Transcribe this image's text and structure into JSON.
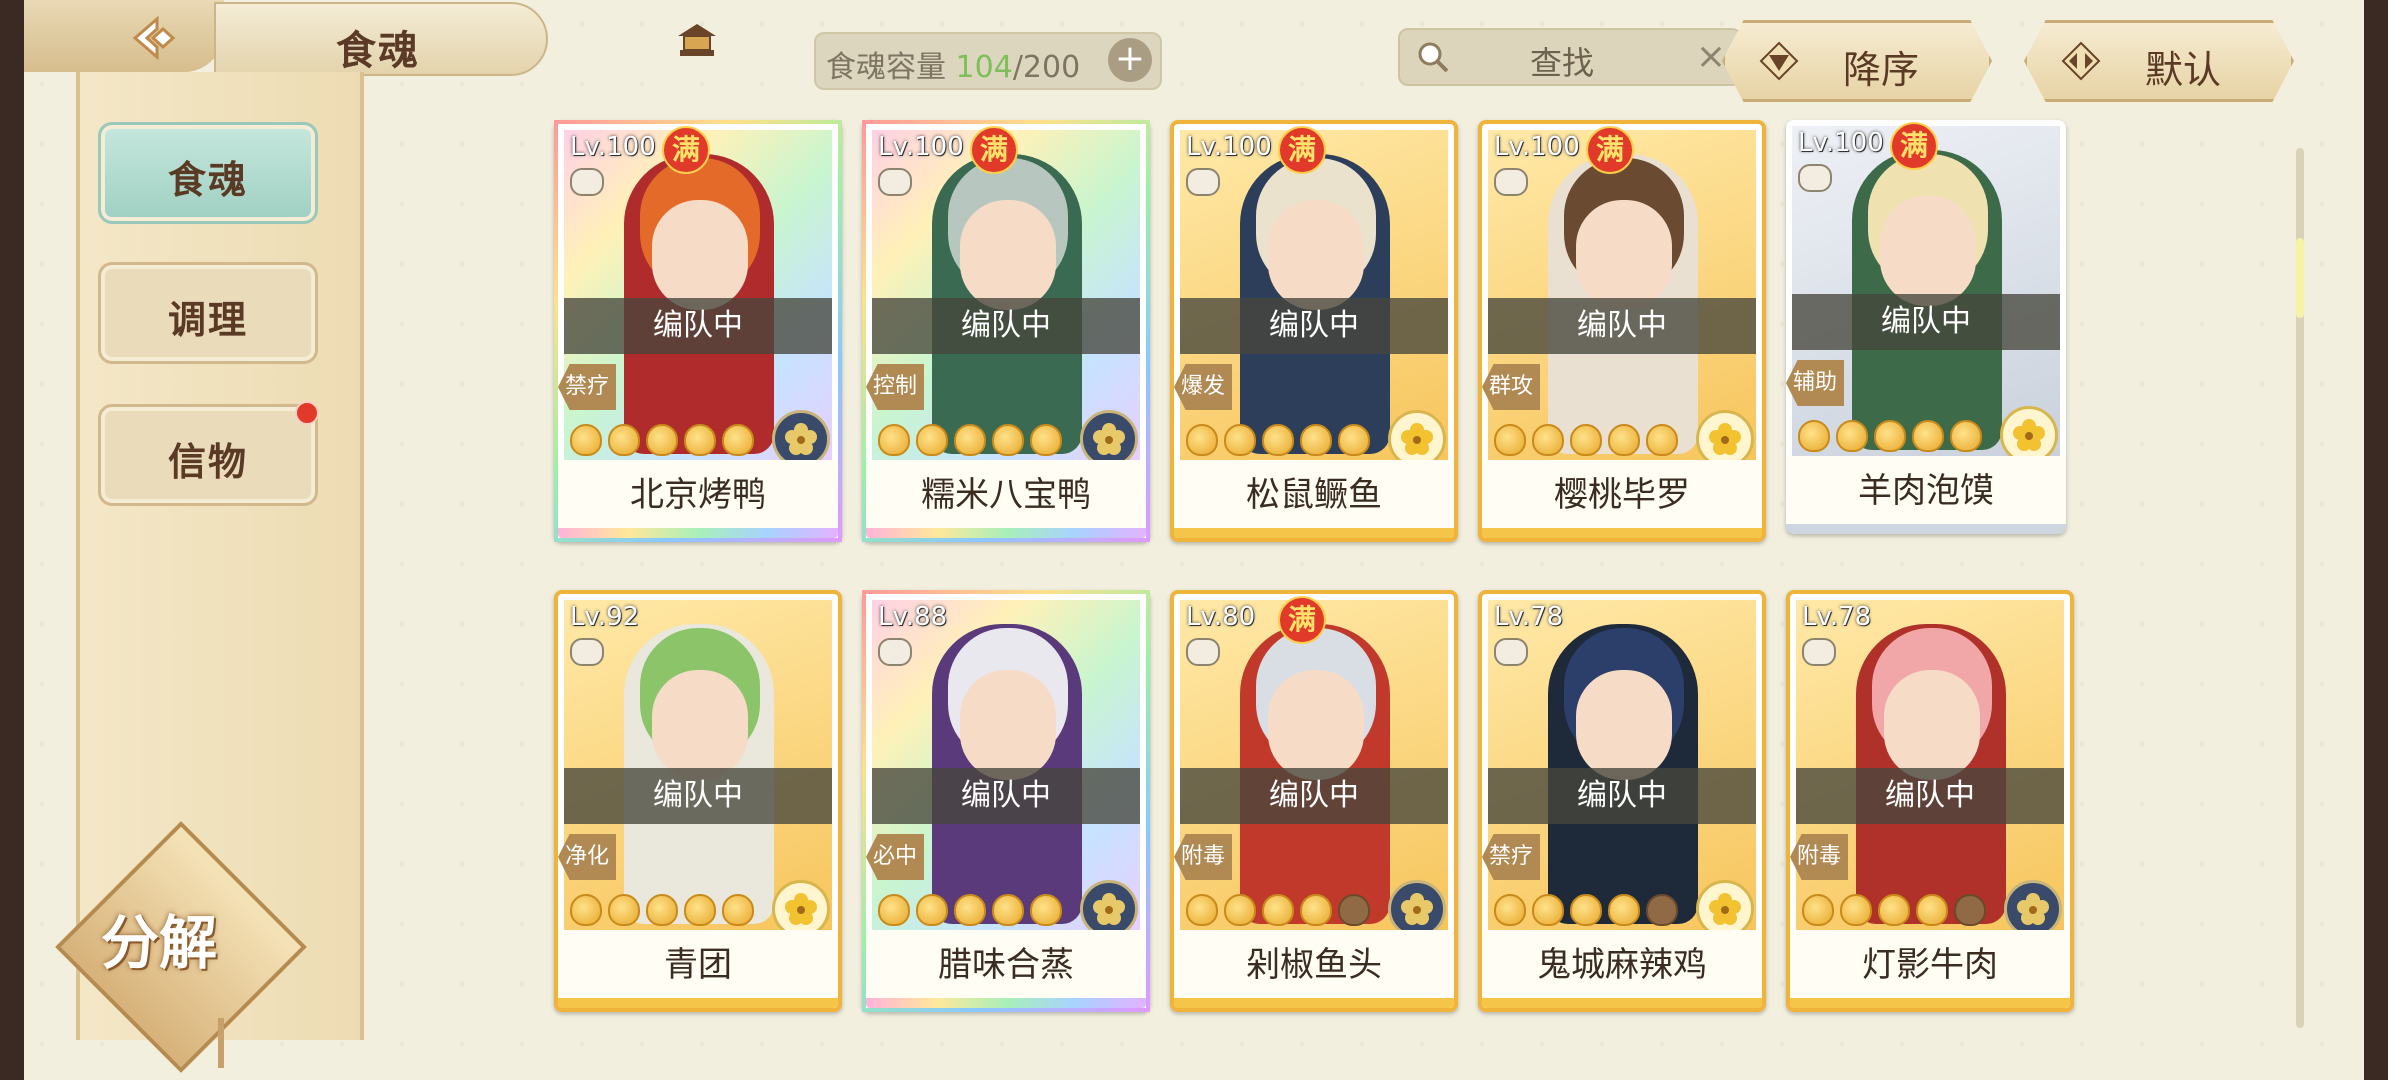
{
  "header": {
    "title": "食魂",
    "capacity": {
      "label": "食魂容量",
      "current": "104",
      "separator": "/",
      "max": "200",
      "add_label": "+"
    },
    "search": {
      "placeholder": "查找",
      "clear_label": "×"
    },
    "sort_desc_label": "降序",
    "sort_default_label": "默认"
  },
  "sidebar": {
    "items": [
      {
        "label": "食魂",
        "active": true
      },
      {
        "label": "调理",
        "active": false
      },
      {
        "label": "信物",
        "active": false,
        "badge": true
      }
    ],
    "decompose_label": "分解"
  },
  "cards": [
    {
      "level": "Lv.100",
      "max": "满",
      "status": "编队中",
      "role": "禁疗",
      "name": "北京烤鸭",
      "rarity": "rainbow",
      "stars": 5,
      "dim_stars": 0,
      "element": "dark",
      "hair": "#e46a2a",
      "outfit": "#b02b2b"
    },
    {
      "level": "Lv.100",
      "max": "满",
      "status": "编队中",
      "role": "控制",
      "name": "糯米八宝鸭",
      "rarity": "rainbow",
      "stars": 5,
      "dim_stars": 0,
      "element": "dark",
      "hair": "#b7c7bf",
      "outfit": "#3a6a52"
    },
    {
      "level": "Lv.100",
      "max": "满",
      "status": "编队中",
      "role": "爆发",
      "name": "松鼠鳜鱼",
      "rarity": "gold",
      "stars": 5,
      "dim_stars": 0,
      "element": "light",
      "hair": "#eae2cc",
      "outfit": "#2d3e5a"
    },
    {
      "level": "Lv.100",
      "max": "满",
      "status": "编队中",
      "role": "群攻",
      "name": "樱桃毕罗",
      "rarity": "gold",
      "stars": 5,
      "dim_stars": 0,
      "element": "light",
      "hair": "#6b4a32",
      "outfit": "#e9e0d2"
    },
    {
      "level": "Lv.100",
      "max": "满",
      "status": "编队中",
      "role": "辅助",
      "name": "羊肉泡馍",
      "rarity": "silver",
      "stars": 5,
      "dim_stars": 0,
      "element": "light",
      "hair": "#efe1b0",
      "outfit": "#3d6b4a"
    },
    {
      "level": "Lv.92",
      "max": "",
      "status": "编队中",
      "role": "净化",
      "name": "青团",
      "rarity": "gold",
      "stars": 5,
      "dim_stars": 0,
      "element": "light",
      "hair": "#8cc46a",
      "outfit": "#eae7dc"
    },
    {
      "level": "Lv.88",
      "max": "",
      "status": "编队中",
      "role": "必中",
      "name": "腊味合蒸",
      "rarity": "rainbow",
      "stars": 5,
      "dim_stars": 0,
      "element": "dark",
      "hair": "#e8e8ee",
      "outfit": "#5a3a7a"
    },
    {
      "level": "Lv.80",
      "max": "满",
      "status": "编队中",
      "role": "附毒",
      "name": "剁椒鱼头",
      "rarity": "gold",
      "stars": 4,
      "dim_stars": 1,
      "element": "dark",
      "hair": "#d9dde4",
      "outfit": "#c0392b"
    },
    {
      "level": "Lv.78",
      "max": "",
      "status": "编队中",
      "role": "禁疗",
      "name": "鬼城麻辣鸡",
      "rarity": "gold",
      "stars": 4,
      "dim_stars": 1,
      "element": "light",
      "hair": "#2c3e6a",
      "outfit": "#1e2a3a"
    },
    {
      "level": "Lv.78",
      "max": "",
      "status": "编队中",
      "role": "附毒",
      "name": "灯影牛肉",
      "rarity": "gold",
      "stars": 4,
      "dim_stars": 1,
      "element": "dark",
      "hair": "#f1a7a7",
      "outfit": "#b0302a"
    }
  ]
}
